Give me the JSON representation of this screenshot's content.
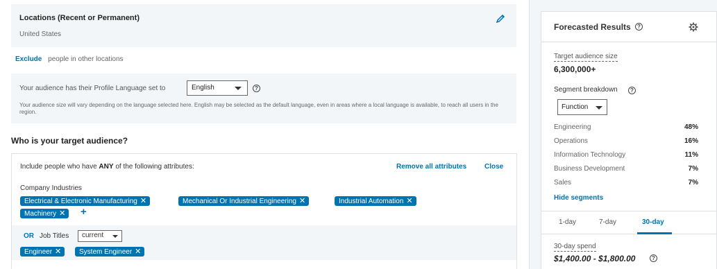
{
  "locations": {
    "title": "Locations (Recent or Permanent)",
    "value": "United States"
  },
  "exclude": {
    "link": "Exclude",
    "text": "people in other locations"
  },
  "language": {
    "label": "Your audience has their Profile Language set to",
    "selected": "English",
    "note": "Your audience size will vary depending on the language selected here. English may be selected as the default language, even in areas where a local language is available, to reach all users in the region."
  },
  "audience": {
    "heading": "Who is your target audience?",
    "include_prefix": "Include people who have",
    "include_any": "ANY",
    "include_suffix": "of the following attributes:",
    "remove_all": "Remove all attributes",
    "close": "Close",
    "industries_label": "Company Industries",
    "industries": [
      "Electrical & Electronic Manufacturing",
      "Mechanical Or Industrial Engineering",
      "Industrial Automation",
      "Machinery"
    ],
    "or_label": "OR",
    "job_titles_label": "Job Titles",
    "job_titles_mode": "current",
    "job_titles": [
      "Engineer",
      "System Engineer"
    ],
    "remove_glyph": "✕",
    "add_glyph": "+"
  },
  "forecast": {
    "title": "Forecasted Results",
    "target_label": "Target audience size",
    "target_value": "6,300,000+",
    "segment_label": "Segment breakdown",
    "segment_selected": "Function",
    "segments": [
      {
        "name": "Engineering",
        "pct": "48%"
      },
      {
        "name": "Operations",
        "pct": "16%"
      },
      {
        "name": "Information Technology",
        "pct": "11%"
      },
      {
        "name": "Business Development",
        "pct": "7%"
      },
      {
        "name": "Sales",
        "pct": "7%"
      }
    ],
    "hide_segments": "Hide segments",
    "tabs": [
      "1-day",
      "7-day",
      "30-day"
    ],
    "active_tab": "30-day",
    "spend_label": "30-day spend",
    "spend_value": "$1,400.00 - $1,800.00"
  },
  "help_glyph": "?",
  "colors": {
    "accent": "#0073b1",
    "panel_bg": "#f3f6f8"
  }
}
